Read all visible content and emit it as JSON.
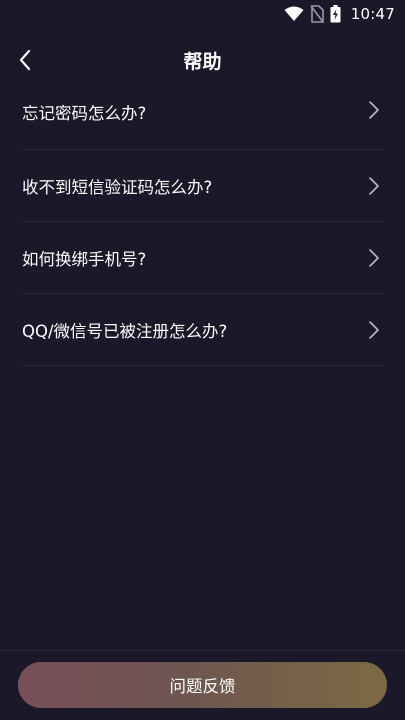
{
  "status_bar": {
    "time": "10:47"
  },
  "header": {
    "title": "帮助"
  },
  "faq": {
    "items": [
      {
        "label": "忘记密码怎么办?"
      },
      {
        "label": "收不到短信验证码怎么办?"
      },
      {
        "label": "如何换绑手机号?"
      },
      {
        "label": "QQ/微信号已被注册怎么办?"
      }
    ]
  },
  "footer": {
    "feedback_label": "问题反馈"
  },
  "colors": {
    "background": "#1b1829",
    "divider": "#2e2b3d",
    "text": "#ffffff",
    "chevron": "#bdbac8"
  },
  "icons": {
    "back": "chevron-left-icon",
    "item_arrow": "chevron-right-icon",
    "wifi": "wifi-icon",
    "sim": "no-sim-icon",
    "battery": "battery-charging-icon"
  }
}
